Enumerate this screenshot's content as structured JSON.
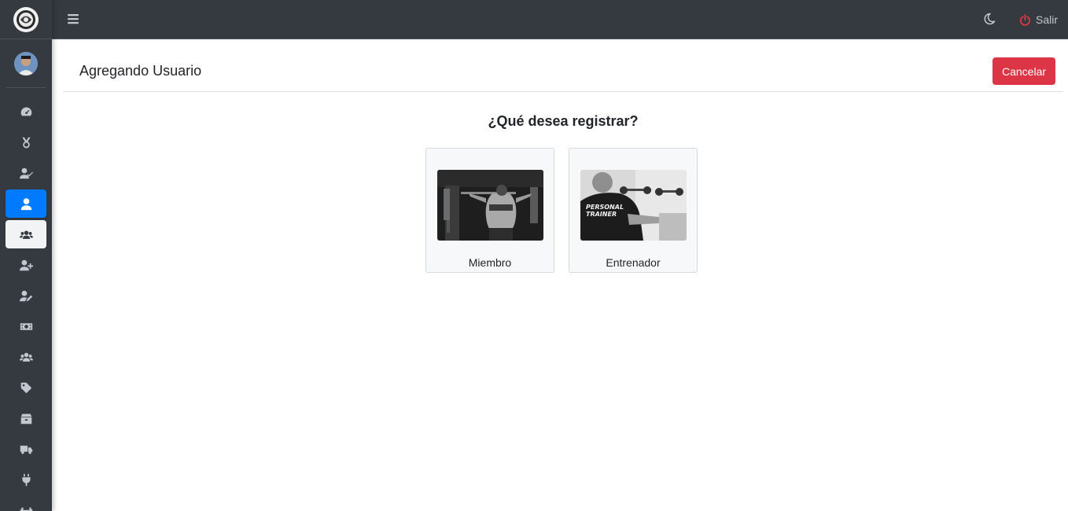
{
  "topbar": {
    "logout_label": "Salir"
  },
  "header": {
    "title": "Agregando Usuario",
    "cancel_label": "Cancelar"
  },
  "main": {
    "question": "¿Qué desea registrar?",
    "options": [
      {
        "label": "Miembro"
      },
      {
        "label": "Entrenador",
        "image_text_1": "PERSONAL",
        "image_text_2": "TRAINER"
      }
    ]
  },
  "sidebar": {
    "items": [
      {
        "icon": "dashboard-icon"
      },
      {
        "icon": "medal-icon"
      },
      {
        "icon": "user-check-icon"
      },
      {
        "icon": "user-icon",
        "state": "active"
      },
      {
        "icon": "users-icon",
        "state": "open"
      },
      {
        "icon": "user-plus-icon"
      },
      {
        "icon": "user-edit-icon"
      },
      {
        "icon": "money-bill-icon"
      },
      {
        "icon": "users-group-icon"
      },
      {
        "icon": "tag-icon"
      },
      {
        "icon": "box-icon"
      },
      {
        "icon": "truck-icon"
      },
      {
        "icon": "plug-icon"
      },
      {
        "icon": "dumbbell-icon"
      }
    ]
  },
  "colors": {
    "sidebar_bg": "#343a40",
    "active": "#007bff",
    "danger": "#dc3545"
  }
}
